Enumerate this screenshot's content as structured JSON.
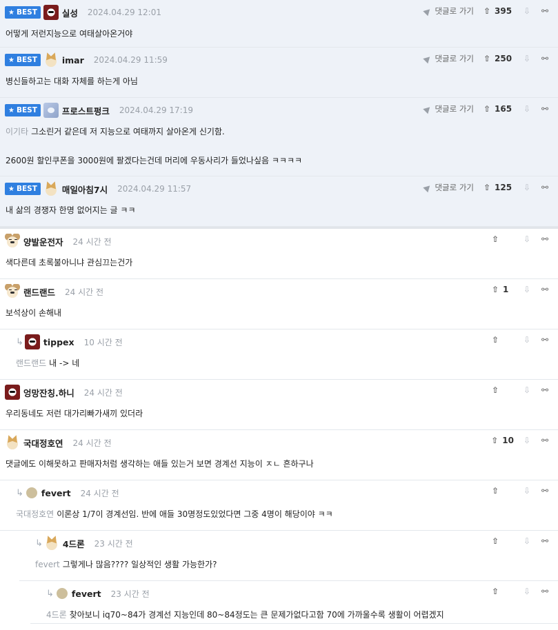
{
  "best_badge": "BEST",
  "goto_label": "댓글로 가기",
  "best_comments": [
    {
      "nick": "실성",
      "avatar": "red",
      "time": "2024.04.29 12:01",
      "likes": "395",
      "lines": [
        "어떻게 저런지능으로 여태살아온거야"
      ]
    },
    {
      "nick": "imar",
      "avatar": "fox",
      "time": "2024.04.29 11:59",
      "likes": "250",
      "lines": [
        "병신들하고는 대화 자체를 하는게 아님"
      ]
    },
    {
      "nick": "프로스트펑크",
      "avatar": "ice",
      "time": "2024.04.29 17:19",
      "likes": "165",
      "mention": "이기타",
      "lines": [
        "그소린거 같은데 저 지능으로 여태까지 살아온게 신기함.",
        "",
        "2600원 할인쿠폰을 3000원에 팔겠다는건데 머리에 우동사리가 들었나싶음 ㅋㅋㅋㅋ"
      ]
    },
    {
      "nick": "매일아침7시",
      "avatar": "fox",
      "time": "2024.04.29 11:57",
      "likes": "125",
      "lines": [
        "내 삶의 경쟁자 한명 없어지는 글 ㅋㅋ"
      ]
    }
  ],
  "comments": [
    {
      "nick": "양발운전자",
      "avatar": "dog",
      "time": "24 시간 전",
      "likes": "",
      "text": "색다른데 초록불아니냐 관심끄는건가",
      "depth": 0
    },
    {
      "nick": "랜드랜드",
      "avatar": "dog",
      "time": "24 시간 전",
      "likes": "1",
      "text": "보석상이 손해내",
      "depth": 0
    },
    {
      "nick": "tippex",
      "avatar": "red",
      "time": "10 시간 전",
      "likes": "",
      "mention": "랜드랜드",
      "text": "내 -> 네",
      "depth": 1
    },
    {
      "nick": "엉망잔칭.하니",
      "avatar": "red",
      "time": "24 시간 전",
      "likes": "",
      "text": "우리동네도 저런 대가리빠가새끼 있더라",
      "depth": 0
    },
    {
      "nick": "국대정호연",
      "avatar": "fox",
      "time": "24 시간 전",
      "likes": "10",
      "text": "댓글에도 이해못하고 판매자처럼 생각하는 애들 있는거 보면 경계선 지능이 ㅈㄴ 흔하구나",
      "depth": 0
    },
    {
      "nick": "fevert",
      "avatar": "dot",
      "time": "24 시간 전",
      "likes": "",
      "mention": "국대정호연",
      "text": "이론상 1/7이 경계선임. 반에 애들 30명정도있었다면 그중 4명이 해당이야 ㅋㅋ",
      "depth": 1
    },
    {
      "nick": "4드론",
      "avatar": "fox",
      "time": "23 시간 전",
      "likes": "",
      "mention": "fevert",
      "text": "그렇게나 많음???? 일상적인 생활 가능한가?",
      "depth": 2
    },
    {
      "nick": "fevert",
      "avatar": "dot",
      "time": "23 시간 전",
      "likes": "",
      "mention": "4드론",
      "text": "찾아보니 iq70~84가 경계선 지능인데 80~84정도는 큰 문제가없다고함 70에 가까울수록 생활이 어렵겠지",
      "depth": 3
    }
  ]
}
